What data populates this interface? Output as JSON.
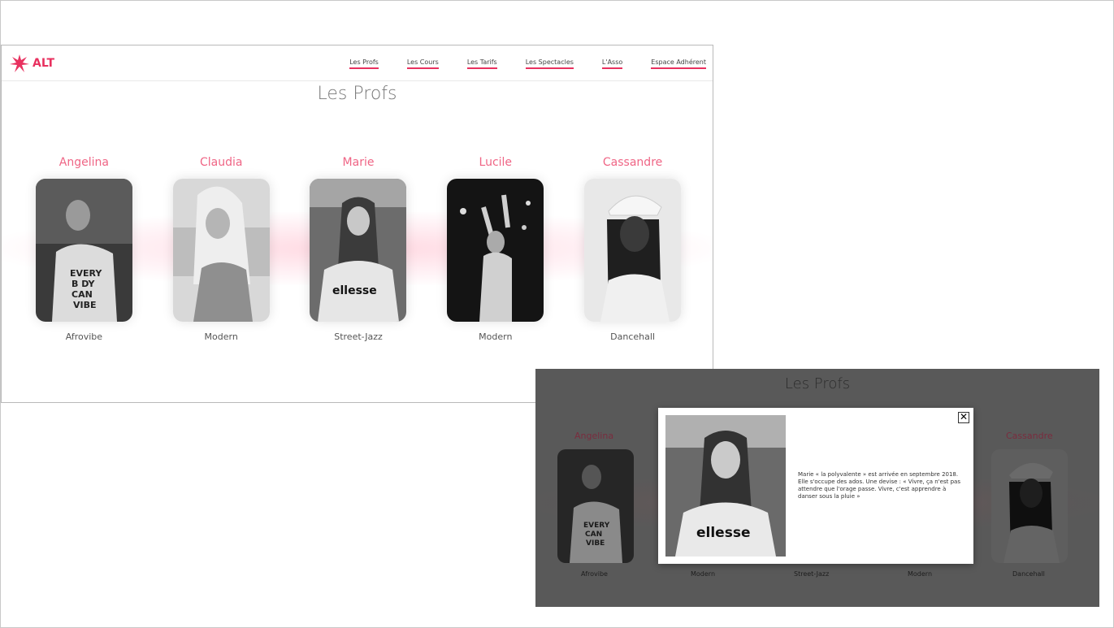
{
  "brand": {
    "name": "ALT",
    "color": "#e8315f"
  },
  "nav": {
    "items": [
      "Les Profs",
      "Les Cours",
      "Les Tarifs",
      "Les Spectacles",
      "L'Asso",
      "Espace Adhérent"
    ]
  },
  "page_title": "Les Profs",
  "profs": [
    {
      "name": "Angelina",
      "style": "Afrovibe",
      "photo_icon": "teacher-photo"
    },
    {
      "name": "Claudia",
      "style": "Modern",
      "photo_icon": "teacher-photo"
    },
    {
      "name": "Marie",
      "style": "Street-Jazz",
      "photo_icon": "teacher-photo"
    },
    {
      "name": "Lucile",
      "style": "Modern",
      "photo_icon": "teacher-photo"
    },
    {
      "name": "Cassandre",
      "style": "Dancehall",
      "photo_icon": "teacher-photo"
    }
  ],
  "modal_view": {
    "title": "Les Profs",
    "visible_names": [
      "Angelina",
      "Cassandre"
    ],
    "styles": [
      "Afrovibe",
      "Modern",
      "Street-Jazz",
      "Modern",
      "Dancehall"
    ],
    "dialog": {
      "text": "Marie « la polyvalente » est arrivée en septembre 2018. Elle s'occupe des ados. Une devise : « Vivre, ça n'est pas attendre que l'orage passe. Vivre, c'est apprendre à danser sous la pluie »",
      "close_label": "✕",
      "photo_icon": "teacher-photo"
    }
  },
  "colors": {
    "accent": "#e8315f",
    "name": "#ef6585",
    "overlay": "#595959"
  }
}
